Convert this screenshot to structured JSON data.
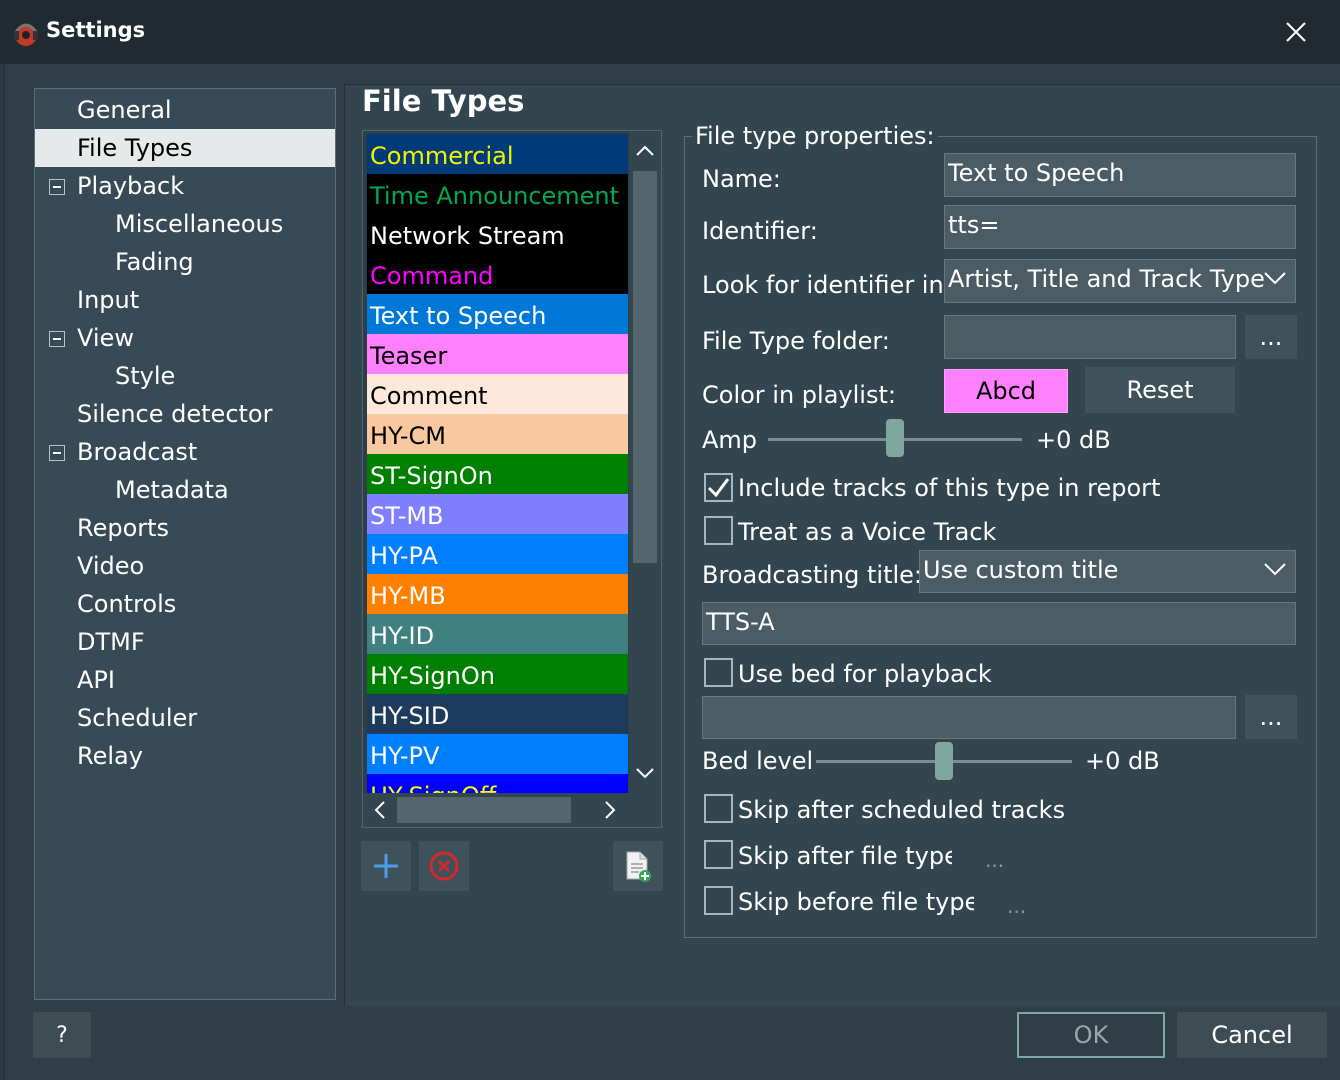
{
  "window": {
    "title": "Settings"
  },
  "nav": {
    "items": [
      {
        "label": "General"
      },
      {
        "label": "File Types"
      },
      {
        "label": "Playback"
      },
      {
        "label": "Miscellaneous"
      },
      {
        "label": "Fading"
      },
      {
        "label": "Input"
      },
      {
        "label": "View"
      },
      {
        "label": "Style"
      },
      {
        "label": "Silence detector"
      },
      {
        "label": "Broadcast"
      },
      {
        "label": "Metadata"
      },
      {
        "label": "Reports"
      },
      {
        "label": "Video"
      },
      {
        "label": "Controls"
      },
      {
        "label": "DTMF"
      },
      {
        "label": "API"
      },
      {
        "label": "Scheduler"
      },
      {
        "label": "Relay"
      }
    ]
  },
  "section_title": "File Types",
  "file_types": [
    {
      "label": "Commercial",
      "bg": "#003a78",
      "fg": "#f2f200"
    },
    {
      "label": "Time Announcement",
      "bg": "#000000",
      "fg": "#00a850"
    },
    {
      "label": "Network Stream",
      "bg": "#000000",
      "fg": "#ffffff"
    },
    {
      "label": "Command",
      "bg": "#000000",
      "fg": "#ff00ff"
    },
    {
      "label": "Text to Speech",
      "bg": "#0078d7",
      "fg": "#ffffff"
    },
    {
      "label": "Teaser",
      "bg": "#ff80ff",
      "fg": "#000000"
    },
    {
      "label": "Comment",
      "bg": "#fde9dc",
      "fg": "#000000"
    },
    {
      "label": "HY-CM",
      "bg": "#f8c8a0",
      "fg": "#000000"
    },
    {
      "label": "ST-SignOn",
      "bg": "#008000",
      "fg": "#ffffff"
    },
    {
      "label": "ST-MB",
      "bg": "#8080ff",
      "fg": "#ffffff"
    },
    {
      "label": "HY-PA",
      "bg": "#0080ff",
      "fg": "#ffffff"
    },
    {
      "label": "HY-MB",
      "bg": "#ff8000",
      "fg": "#ffffff"
    },
    {
      "label": "HY-ID",
      "bg": "#408080",
      "fg": "#ffffff"
    },
    {
      "label": "HY-SignOn",
      "bg": "#008000",
      "fg": "#ffffff"
    },
    {
      "label": "HY-SID",
      "bg": "#1f3b5c",
      "fg": "#ffffff"
    },
    {
      "label": "HY-PV",
      "bg": "#0080ff",
      "fg": "#ffffff"
    },
    {
      "label": "HY-SignOff",
      "bg": "#0000ff",
      "fg": "#ffff00"
    }
  ],
  "props": {
    "legend": "File type properties:",
    "name_label": "Name:",
    "name_value": "Text to Speech",
    "identifier_label": "Identifier:",
    "identifier_value": "tts=",
    "look_label": "Look for identifier in:",
    "look_value": "Artist, Title and Track Type",
    "folder_label": "File Type folder:",
    "folder_value": "",
    "browse_label": "...",
    "color_label": "Color in playlist:",
    "color_sample": "Abcd",
    "color_sample_bg": "#ff80ff",
    "reset_label": "Reset",
    "amp_label": "Amp",
    "amp_value": "+0 dB",
    "include_report_label": "Include tracks of this type in report",
    "include_report_checked": true,
    "voice_track_label": "Treat as a Voice Track",
    "voice_track_checked": false,
    "broadcast_title_label": "Broadcasting title:",
    "broadcast_title_value": "Use custom title",
    "custom_title_value": "TTS-A",
    "use_bed_label": "Use bed for playback",
    "use_bed_checked": false,
    "bed_file_value": "",
    "bed_browse_label": "...",
    "bed_level_label": "Bed level",
    "bed_level_value": "+0 dB",
    "skip_after_scheduled_label": "Skip after scheduled tracks",
    "skip_after_types_label": "Skip after file types",
    "skip_before_types_label": "Skip before file types",
    "skip_ellipsis": "..."
  },
  "buttons": {
    "help": "?",
    "ok": "OK",
    "cancel": "Cancel"
  },
  "colors": {
    "accent": "#7aa8a2",
    "selection": "#e6e9ea",
    "background": "#2f3e47"
  }
}
